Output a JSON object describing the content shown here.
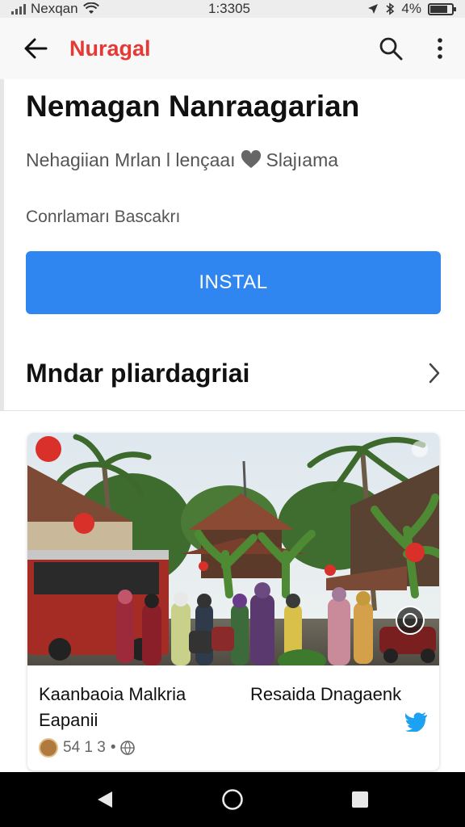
{
  "status_bar": {
    "carrier": "Nexqan",
    "time": "1:3305",
    "battery": "4%"
  },
  "app_bar": {
    "title": "Nuragal",
    "title_color": "#e53935"
  },
  "app": {
    "title": "Nemagan Nanraagarian",
    "subtitle_left": "Nehagiian Mrlan l lençaaı",
    "subtitle_right": "Slajıama",
    "meta": "Conrlamarı Bascakrı",
    "install_label": "INSTAL",
    "install_color": "#2f86f0"
  },
  "section": {
    "title": "Mndar pliardagriai"
  },
  "card": {
    "text_left": "Kaanbaoia Malkria Eapanii",
    "text_right": "Resaida Dnagaenk",
    "footer_count": "54 1 3",
    "footer_sep": "•",
    "bird_color": "#1da1f2"
  },
  "icons": [
    "back-arrow-icon",
    "search-icon",
    "more-vert-icon",
    "heart-icon",
    "chevron-right-icon",
    "bird-icon",
    "globe-icon",
    "nav-back-icon",
    "nav-home-icon",
    "nav-recents-icon"
  ]
}
